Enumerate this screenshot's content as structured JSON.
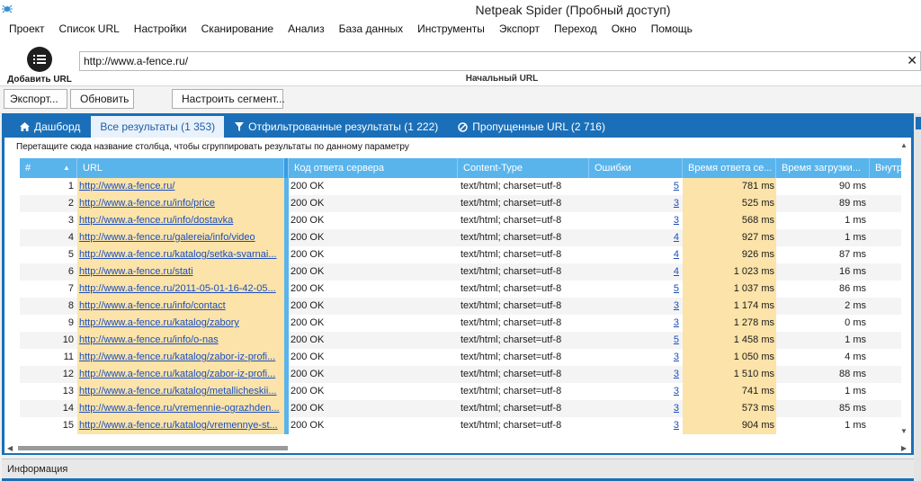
{
  "window": {
    "title": "Netpeak Spider (Пробный доступ)"
  },
  "menu": [
    "Проект",
    "Список URL",
    "Настройки",
    "Сканирование",
    "Анализ",
    "База данных",
    "Инструменты",
    "Экспорт",
    "Переход",
    "Окно",
    "Помощь"
  ],
  "url_bar": {
    "add_url_label": "Добавить URL",
    "value": "http://www.a-fence.ru/",
    "start_url_label": "Начальный URL",
    "clear_glyph": "✕"
  },
  "toolbar": {
    "export_label": "Экспорт...",
    "refresh_label": "Обновить",
    "segment_label": "Настроить сегмент..."
  },
  "tabs": {
    "dashboard": "Дашборд",
    "all_results": "Все результаты (1 353)",
    "filtered": "Отфильтрованные результаты (1 222)",
    "skipped": "Пропущенные URL (2 716)"
  },
  "grid": {
    "group_hint": "Перетащите сюда название столбца, чтобы сгруппировать результаты по данному параметру",
    "columns": [
      "#",
      "URL",
      "Код ответа сервера",
      "Content-Type",
      "Ошибки",
      "Время ответа се...",
      "Время загрузки...",
      "Внутр"
    ],
    "rows": [
      {
        "n": "1",
        "url": "http://www.a-fence.ru/",
        "code": "200 OK",
        "ct": "text/html; charset=utf-8",
        "err": "5",
        "resp": "781 ms",
        "load": "90 ms"
      },
      {
        "n": "2",
        "url": "http://www.a-fence.ru/info/price",
        "code": "200 OK",
        "ct": "text/html; charset=utf-8",
        "err": "3",
        "resp": "525 ms",
        "load": "89 ms"
      },
      {
        "n": "3",
        "url": "http://www.a-fence.ru/info/dostavka",
        "code": "200 OK",
        "ct": "text/html; charset=utf-8",
        "err": "3",
        "resp": "568 ms",
        "load": "1 ms"
      },
      {
        "n": "4",
        "url": "http://www.a-fence.ru/galereia/info/video",
        "code": "200 OK",
        "ct": "text/html; charset=utf-8",
        "err": "4",
        "resp": "927 ms",
        "load": "1 ms"
      },
      {
        "n": "5",
        "url": "http://www.a-fence.ru/katalog/setka-svarnai...",
        "code": "200 OK",
        "ct": "text/html; charset=utf-8",
        "err": "4",
        "resp": "926 ms",
        "load": "87 ms"
      },
      {
        "n": "6",
        "url": "http://www.a-fence.ru/stati",
        "code": "200 OK",
        "ct": "text/html; charset=utf-8",
        "err": "4",
        "resp": "1 023 ms",
        "load": "16 ms"
      },
      {
        "n": "7",
        "url": "http://www.a-fence.ru/2011-05-01-16-42-05...",
        "code": "200 OK",
        "ct": "text/html; charset=utf-8",
        "err": "5",
        "resp": "1 037 ms",
        "load": "86 ms"
      },
      {
        "n": "8",
        "url": "http://www.a-fence.ru/info/contact",
        "code": "200 OK",
        "ct": "text/html; charset=utf-8",
        "err": "3",
        "resp": "1 174 ms",
        "load": "2 ms"
      },
      {
        "n": "9",
        "url": "http://www.a-fence.ru/katalog/zabory",
        "code": "200 OK",
        "ct": "text/html; charset=utf-8",
        "err": "3",
        "resp": "1 278 ms",
        "load": "0 ms"
      },
      {
        "n": "10",
        "url": "http://www.a-fence.ru/info/o-nas",
        "code": "200 OK",
        "ct": "text/html; charset=utf-8",
        "err": "5",
        "resp": "1 458 ms",
        "load": "1 ms"
      },
      {
        "n": "11",
        "url": "http://www.a-fence.ru/katalog/zabor-iz-profi...",
        "code": "200 OK",
        "ct": "text/html; charset=utf-8",
        "err": "3",
        "resp": "1 050 ms",
        "load": "4 ms"
      },
      {
        "n": "12",
        "url": "http://www.a-fence.ru/katalog/zabor-iz-profi...",
        "code": "200 OK",
        "ct": "text/html; charset=utf-8",
        "err": "3",
        "resp": "1 510 ms",
        "load": "88 ms"
      },
      {
        "n": "13",
        "url": "http://www.a-fence.ru/katalog/metallicheskii...",
        "code": "200 OK",
        "ct": "text/html; charset=utf-8",
        "err": "3",
        "resp": "741 ms",
        "load": "1 ms"
      },
      {
        "n": "14",
        "url": "http://www.a-fence.ru/vremennie-ograzhden...",
        "code": "200 OK",
        "ct": "text/html; charset=utf-8",
        "err": "3",
        "resp": "573 ms",
        "load": "85 ms"
      },
      {
        "n": "15",
        "url": "http://www.a-fence.ru/katalog/vremennye-st...",
        "code": "200 OK",
        "ct": "text/html; charset=utf-8",
        "err": "3",
        "resp": "904 ms",
        "load": "1 ms"
      }
    ]
  },
  "info_panel": {
    "label": "Информация"
  },
  "colors": {
    "accent": "#1a6fb8",
    "header": "#59b4ec",
    "highlight": "#fbe3a9",
    "link": "#1a4fbf"
  }
}
